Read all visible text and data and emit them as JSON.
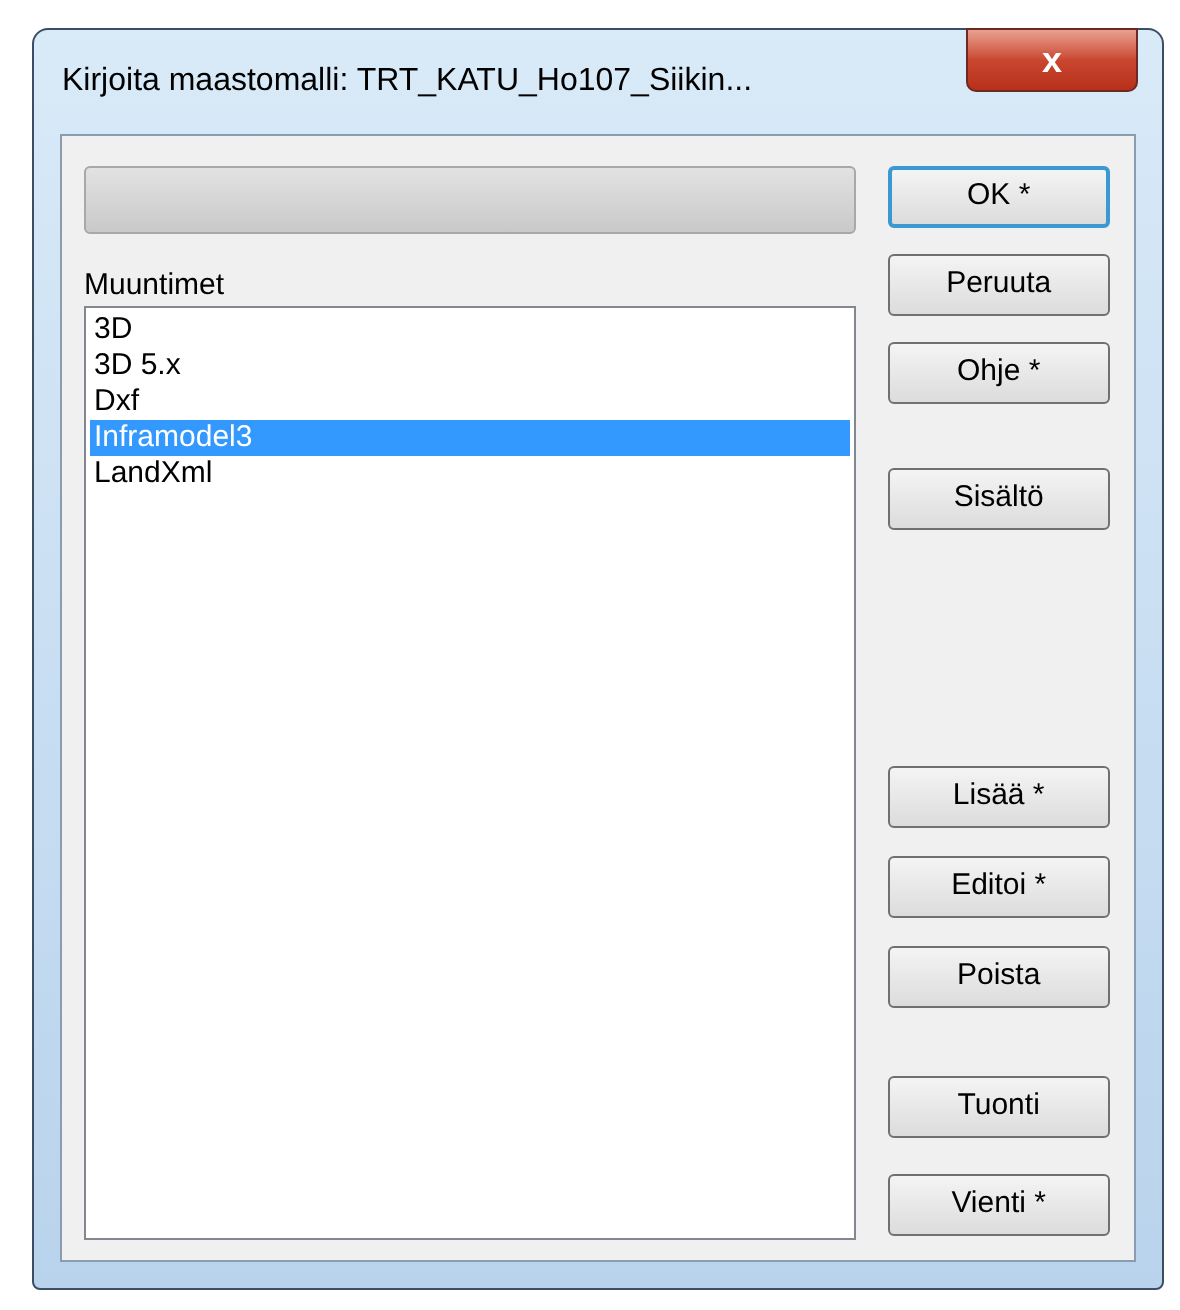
{
  "window": {
    "title": "Kirjoita maastomalli: TRT_KATU_Ho107_Siikin...",
    "close": "x"
  },
  "progress": {
    "level": 0
  },
  "list": {
    "label": "Muuntimet",
    "items": [
      {
        "label": "3D",
        "selected": false
      },
      {
        "label": "3D 5.x",
        "selected": false
      },
      {
        "label": "Dxf",
        "selected": false
      },
      {
        "label": "Inframodel3",
        "selected": true
      },
      {
        "label": "LandXml",
        "selected": false
      }
    ]
  },
  "button_groups": [
    [
      {
        "label": "OK *",
        "default": true
      },
      {
        "label": "Peruuta",
        "default": false
      },
      {
        "label": "Ohje *",
        "default": false
      }
    ],
    [
      {
        "label": "Sisältö",
        "default": false
      }
    ],
    [
      {
        "label": "Lisää *",
        "default": false
      },
      {
        "label": "Editoi *",
        "default": false
      },
      {
        "label": "Poista",
        "default": false
      }
    ],
    [
      {
        "label": "Tuonti",
        "default": false
      },
      {
        "label": "Vienti *",
        "default": false
      }
    ]
  ]
}
